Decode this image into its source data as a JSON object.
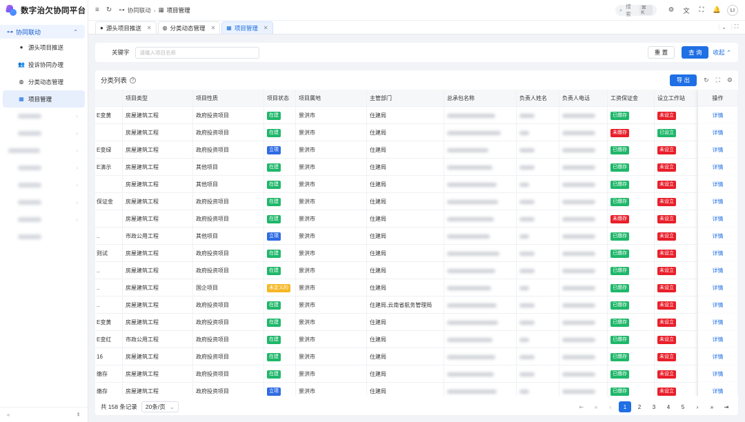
{
  "app": {
    "title": "数字治欠协同平台"
  },
  "sidebar": {
    "group": "协同联动",
    "items": [
      {
        "label": "源头项目推送",
        "icon": "push-icon"
      },
      {
        "label": "投诉协同办理",
        "icon": "people-icon"
      },
      {
        "label": "分类动态管理",
        "icon": "category-icon"
      },
      {
        "label": "项目管理",
        "icon": "project-icon"
      }
    ]
  },
  "topbar": {
    "breadcrumb": [
      "协同联动",
      "项目管理"
    ],
    "search_label": "搜索",
    "search_kbd": "⌘ K",
    "avatar": "LI"
  },
  "tabs": [
    {
      "label": "源头项目推送",
      "active": false
    },
    {
      "label": "分类动态管理",
      "active": false
    },
    {
      "label": "项目管理",
      "active": true
    }
  ],
  "filter": {
    "keyword_label": "关键字",
    "keyword_placeholder": "请输入项目名称",
    "reset_label": "重 置",
    "query_label": "查 询",
    "collapse_label": "收起"
  },
  "table": {
    "title": "分类列表",
    "export_label": "导 出",
    "columns": [
      "",
      "项目类型",
      "项目性质",
      "项目状态",
      "项目属地",
      "主管部门",
      "总承包名称",
      "负责人姓名",
      "负责人电话",
      "工资保证金",
      "设立工作站",
      "操作"
    ],
    "rows": [
      {
        "name": "E变黄",
        "type": "房屋建筑工程",
        "nature": "政府投资项目",
        "status": "在建",
        "loc": "景洪市",
        "dept": "住建局",
        "deposit": "已缴存",
        "station": "未设立"
      },
      {
        "name": "",
        "type": "房屋建筑工程",
        "nature": "政府投资项目",
        "status": "在建",
        "loc": "景洪市",
        "dept": "住建局",
        "deposit": "未缴存",
        "station": "已设立"
      },
      {
        "name": "E变绿",
        "type": "房屋建筑工程",
        "nature": "政府投资项目",
        "status": "立项",
        "loc": "景洪市",
        "dept": "住建局",
        "deposit": "已缴存",
        "station": "未设立"
      },
      {
        "name": "E演示",
        "type": "房屋建筑工程",
        "nature": "其他项目",
        "status": "在建",
        "loc": "景洪市",
        "dept": "住建局",
        "deposit": "已缴存",
        "station": "未设立"
      },
      {
        "name": "",
        "type": "房屋建筑工程",
        "nature": "其他项目",
        "status": "在建",
        "loc": "景洪市",
        "dept": "住建局",
        "deposit": "已缴存",
        "station": "未设立"
      },
      {
        "name": "保证金",
        "type": "房屋建筑工程",
        "nature": "政府投资项目",
        "status": "在建",
        "loc": "景洪市",
        "dept": "住建局",
        "deposit": "已缴存",
        "station": "未设立"
      },
      {
        "name": "",
        "type": "房屋建筑工程",
        "nature": "政府投资项目",
        "status": "在建",
        "loc": "景洪市",
        "dept": "住建局",
        "deposit": "未缴存",
        "station": "未设立"
      },
      {
        "name": "..",
        "type": "市政公用工程",
        "nature": "其他项目",
        "status": "立项",
        "loc": "景洪市",
        "dept": "住建局",
        "deposit": "已缴存",
        "station": "未设立"
      },
      {
        "name": "则试",
        "type": "房屋建筑工程",
        "nature": "政府投资项目",
        "status": "在建",
        "loc": "景洪市",
        "dept": "住建局",
        "deposit": "已缴存",
        "station": "未设立"
      },
      {
        "name": "..",
        "type": "房屋建筑工程",
        "nature": "政府投资项目",
        "status": "在建",
        "loc": "景洪市",
        "dept": "住建局",
        "deposit": "已缴存",
        "station": "未设立"
      },
      {
        "name": "..",
        "type": "房屋建筑工程",
        "nature": "国企项目",
        "status": "未定义的",
        "loc": "景洪市",
        "dept": "住建局",
        "deposit": "已缴存",
        "station": "未设立"
      },
      {
        "name": "..",
        "type": "房屋建筑工程",
        "nature": "政府投资项目",
        "status": "在建",
        "loc": "景洪市",
        "dept": "住建局,云南省航务管理局",
        "deposit": "已缴存",
        "station": "未设立"
      },
      {
        "name": "E变黄",
        "type": "房屋建筑工程",
        "nature": "政府投资项目",
        "status": "在建",
        "loc": "景洪市",
        "dept": "住建局",
        "deposit": "已缴存",
        "station": "未设立"
      },
      {
        "name": "E变红",
        "type": "市政公用工程",
        "nature": "政府投资项目",
        "status": "在建",
        "loc": "景洪市",
        "dept": "住建局",
        "deposit": "已缴存",
        "station": "未设立"
      },
      {
        "name": "16",
        "type": "房屋建筑工程",
        "nature": "政府投资项目",
        "status": "在建",
        "loc": "景洪市",
        "dept": "住建局",
        "deposit": "已缴存",
        "station": "未设立"
      },
      {
        "name": "缴存",
        "type": "房屋建筑工程",
        "nature": "政府投资项目",
        "status": "在建",
        "loc": "景洪市",
        "dept": "住建局",
        "deposit": "已缴存",
        "station": "未设立"
      },
      {
        "name": "缴存",
        "type": "房屋建筑工程",
        "nature": "政府投资项目",
        "status": "立项",
        "loc": "景洪市",
        "dept": "住建局",
        "deposit": "已缴存",
        "station": "未设立"
      }
    ],
    "detail_label": "详情"
  },
  "footer": {
    "total": "共 158 条记录",
    "page_size": "20条/页",
    "pages": [
      "1",
      "2",
      "3",
      "4",
      "5"
    ],
    "current_page": "1"
  },
  "colors": {
    "primary": "#1f6fe5",
    "green": "#1fb76a",
    "red": "#e81f2a",
    "orange": "#f6b726",
    "blue": "#2f6be3"
  }
}
